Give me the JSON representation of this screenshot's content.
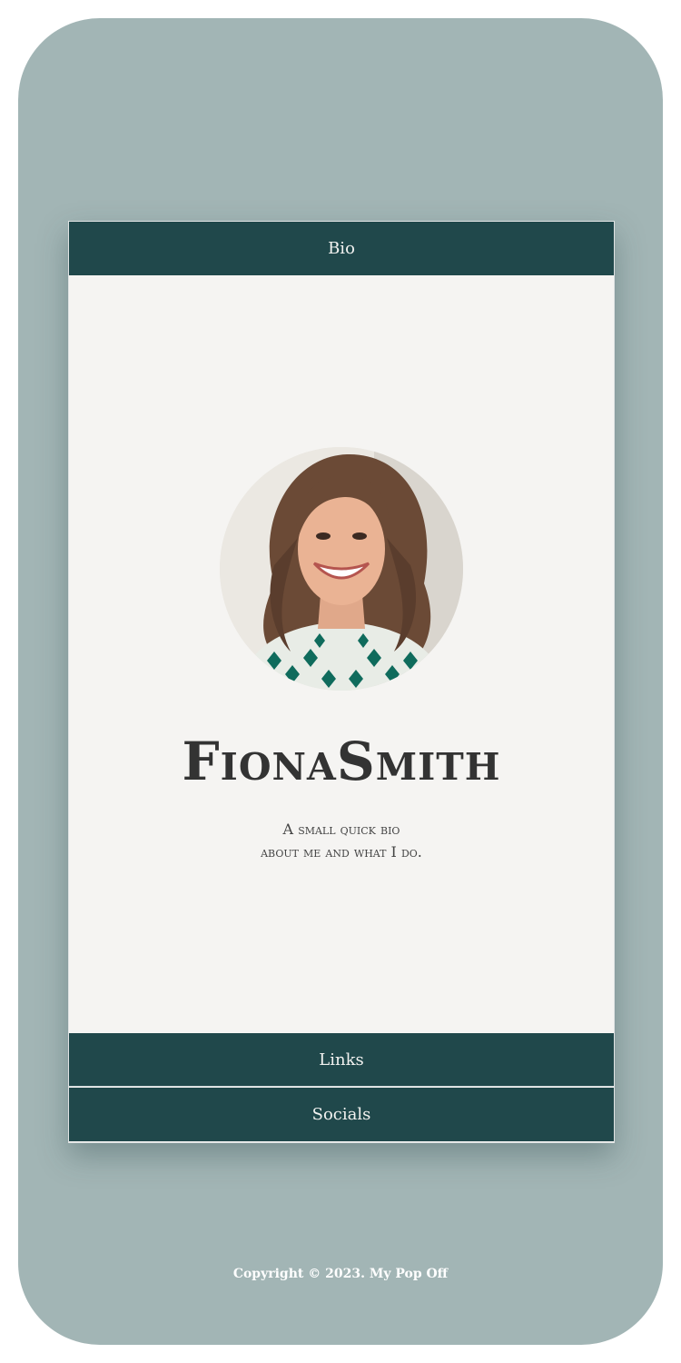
{
  "tabs": {
    "bio": "Bio",
    "links": "Links",
    "socials": "Socials"
  },
  "profile": {
    "name": "FionaSmith",
    "bio_line1": "A small quick bio",
    "bio_line2": "about me and what I do."
  },
  "footer": {
    "copyright": "Copyright © 2023. My Pop Off"
  },
  "colors": {
    "background": "#a2b5b5",
    "card": "#f5f4f2",
    "tab": "#20484b",
    "text": "#333333"
  }
}
